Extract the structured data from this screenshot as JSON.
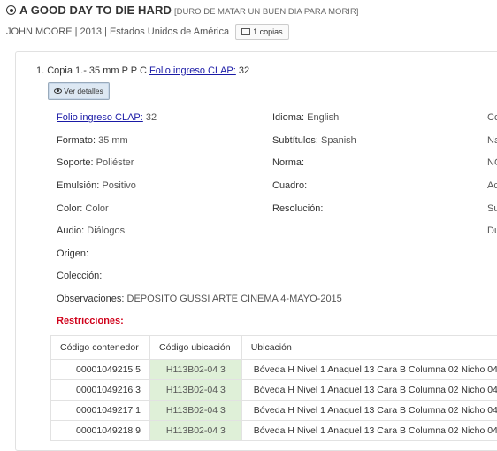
{
  "header": {
    "title": "A GOOD DAY TO DIE HARD",
    "subtitle": "[DURO DE MATAR UN BUEN DIA PARA MORIR]",
    "meta": "JOHN MOORE | 2013 | Estados Unidos de América",
    "copies_label": "1 copias"
  },
  "copy": {
    "prefix": "1. Copia 1.- 35 mm P P C",
    "folio_link": "Folio ingreso CLAP:",
    "folio_value": "32",
    "details_button": "Ver detalles"
  },
  "details": {
    "folio_label": "Folio ingreso CLAP:",
    "folio_value": "32",
    "formato_label": "Formato:",
    "formato_value": "35 mm",
    "soporte_label": "Soporte:",
    "soporte_value": "Poliéster",
    "emulsion_label": "Emulsión:",
    "emulsion_value": "Positivo",
    "color_label": "Color:",
    "color_value": "Color",
    "audio_label": "Audio:",
    "audio_value": "Diálogos",
    "origen_label": "Origen:",
    "coleccion_label": "Colección:",
    "observaciones_label": "Observaciones:",
    "observaciones_value": "DEPOSITO GUSSI ARTE CINEMA 4-MAYO-2015",
    "idioma_label": "Idioma:",
    "idioma_value": "English",
    "subtitulos_label": "Subtítulos:",
    "subtitulos_value": "Spanish",
    "norma_label": "Norma:",
    "cuadro_label": "Cuadro:",
    "resolucion_label": "Resolución:",
    "col3": [
      "Co",
      "Na",
      "NO",
      "Ac",
      "Su",
      "Du"
    ],
    "restricciones_label": "Restricciones:"
  },
  "table": {
    "headers": [
      "Código contenedor",
      "Código ubicación",
      "Ubicación"
    ],
    "rows": [
      [
        "00001049215 5",
        "H113B02-04 3",
        "Bóveda H Nivel 1 Anaquel 13 Cara B Columna 02 Nicho 04"
      ],
      [
        "00001049216 3",
        "H113B02-04 3",
        "Bóveda H Nivel 1 Anaquel 13 Cara B Columna 02 Nicho 04"
      ],
      [
        "00001049217 1",
        "H113B02-04 3",
        "Bóveda H Nivel 1 Anaquel 13 Cara B Columna 02 Nicho 04"
      ],
      [
        "00001049218 9",
        "H113B02-04 3",
        "Bóveda H Nivel 1 Anaquel 13 Cara B Columna 02 Nicho 04"
      ]
    ]
  },
  "colors": {
    "link": "#1a1aa6",
    "restriction": "#d0021b",
    "location_highlight": "#dff0d8"
  }
}
